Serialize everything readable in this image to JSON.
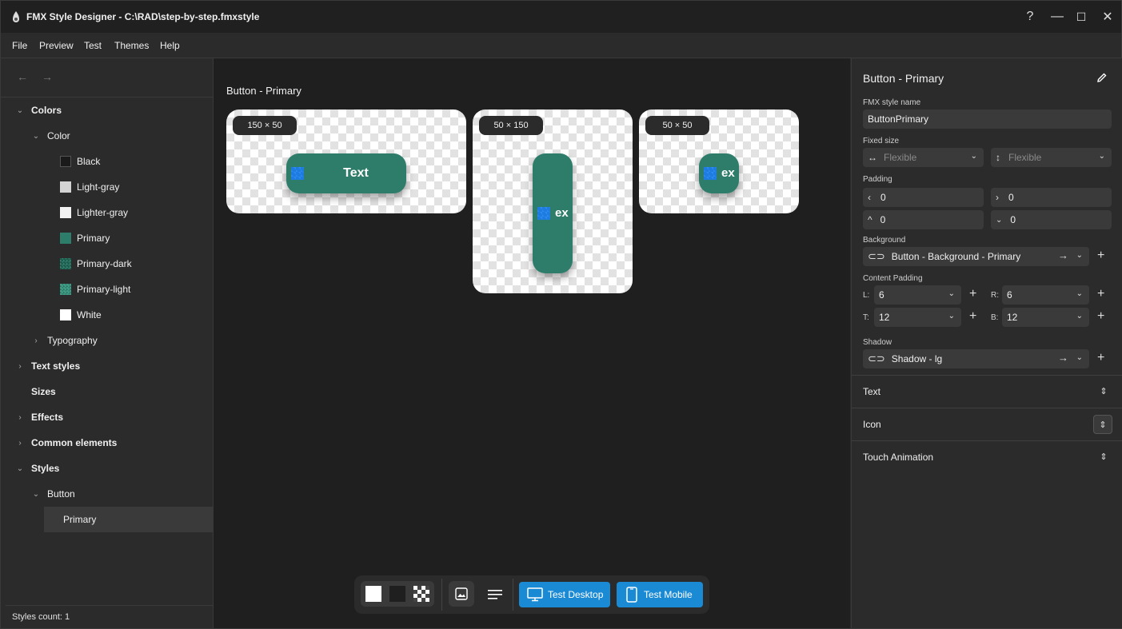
{
  "window": {
    "title": "FMX Style Designer - C:\\RAD\\step-by-step.fmxstyle",
    "help": "?",
    "minimize": "—",
    "maximize": "☐",
    "close": "✕"
  },
  "menu": [
    "File",
    "Preview",
    "Test",
    "Themes",
    "Help"
  ],
  "sidebar": {
    "back": "←",
    "forward": "→",
    "tree": {
      "colors": "Colors",
      "color": "Color",
      "swatches": [
        {
          "label": "Black",
          "color": "#1a1a1a"
        },
        {
          "label": "Light-gray",
          "color": "#d4d4d4"
        },
        {
          "label": "Lighter-gray",
          "color": "#f2f2f2"
        },
        {
          "label": "Primary",
          "color": "#2e7d6b"
        },
        {
          "label": "Primary-dark",
          "color": "#1f5f50"
        },
        {
          "label": "Primary-light",
          "color": "#3f9a83"
        },
        {
          "label": "White",
          "color": "#ffffff"
        }
      ],
      "typography": "Typography",
      "text_styles": "Text styles",
      "sizes": "Sizes",
      "effects": "Effects",
      "common_elements": "Common elements",
      "styles": "Styles",
      "button": "Button",
      "primary": "Primary"
    },
    "status": "Styles count: 1"
  },
  "canvas": {
    "title": "Button - Primary",
    "previews": [
      {
        "size": "150 × 50",
        "text": "Text"
      },
      {
        "size": "50 × 150",
        "text": "ex"
      },
      {
        "size": "50 × 50",
        "text": "ex"
      }
    ],
    "toolbar": {
      "test_desktop": "Test Desktop",
      "test_mobile": "Test Mobile"
    }
  },
  "props": {
    "header": "Button - Primary",
    "style_name_label": "FMX style name",
    "style_name": "ButtonPrimary",
    "fixed_size_label": "Fixed size",
    "fixed_width": "Flexible",
    "fixed_height": "Flexible",
    "padding_label": "Padding",
    "padding": {
      "left": "0",
      "right": "0",
      "top": "0",
      "bottom": "0"
    },
    "background_label": "Background",
    "background": "Button - Background - Primary",
    "content_padding_label": "Content Padding",
    "content_padding": {
      "l_label": "L:",
      "l": "6",
      "r_label": "R:",
      "r": "6",
      "t_label": "T:",
      "t": "12",
      "b_label": "B:",
      "b": "12"
    },
    "shadow_label": "Shadow",
    "shadow": "Shadow - lg",
    "sections": [
      "Text",
      "Icon",
      "Touch Animation"
    ]
  }
}
